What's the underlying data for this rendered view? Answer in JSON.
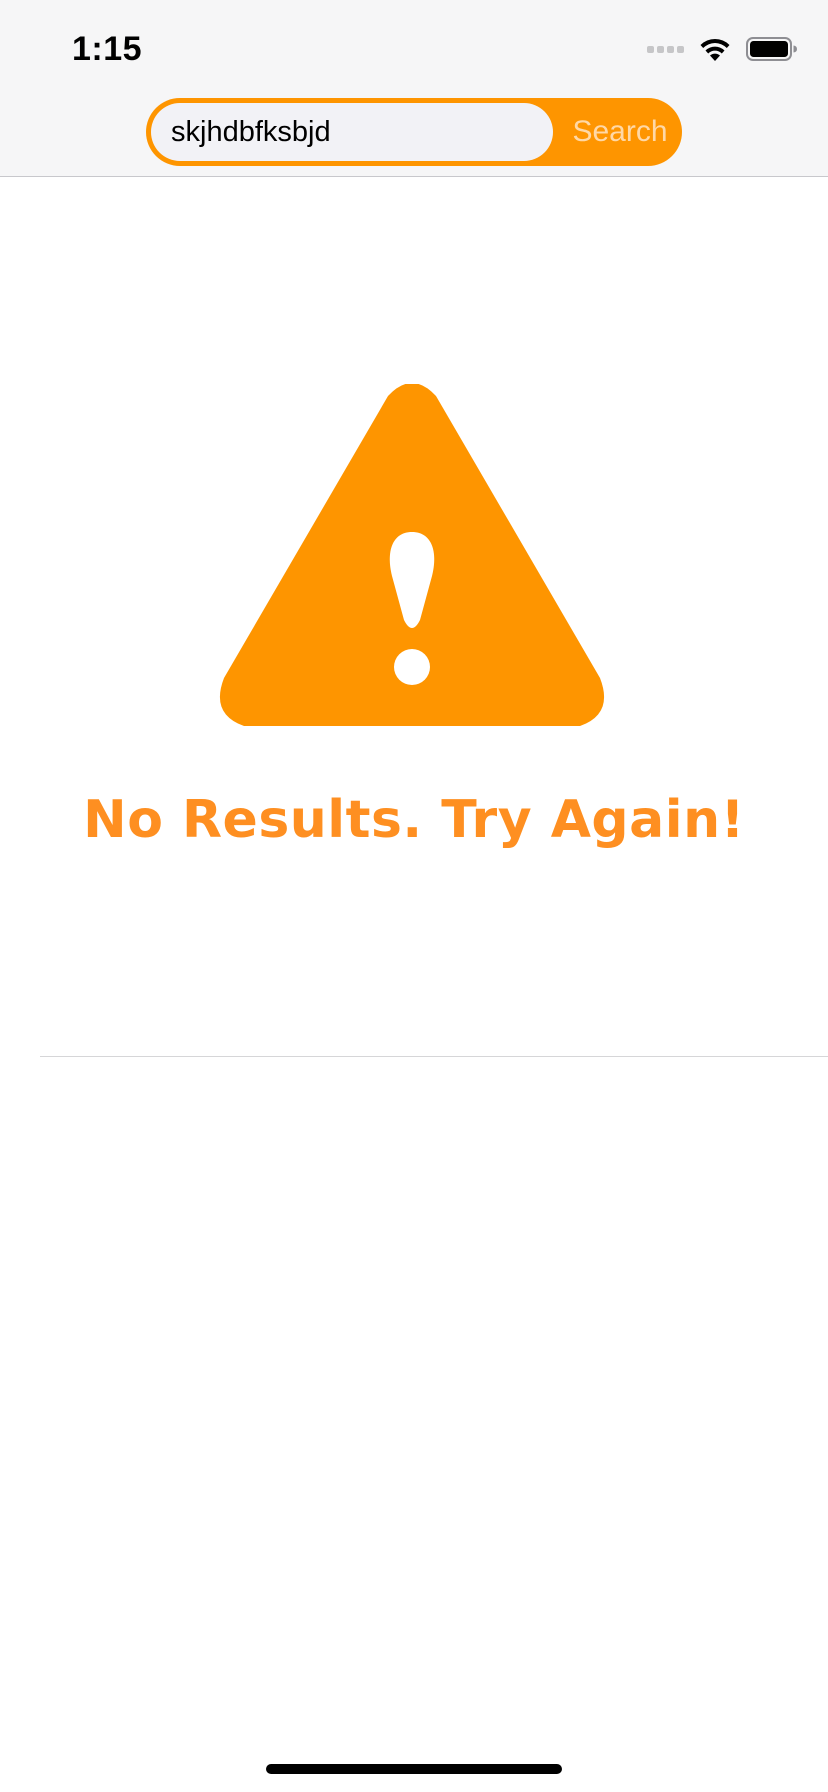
{
  "status_bar": {
    "time": "1:15",
    "signal_icon": "cellular-signal-icon",
    "wifi_icon": "wifi-icon",
    "battery_icon": "battery-icon"
  },
  "search": {
    "value": "skjhdbfksbjd",
    "button_label": "Search"
  },
  "empty_state": {
    "icon": "warning-icon",
    "message": "No Results. Try Again!"
  },
  "colors": {
    "accent": "#fe9500",
    "message": "#fe8f21",
    "search_button_text": "#ffd8a6"
  }
}
